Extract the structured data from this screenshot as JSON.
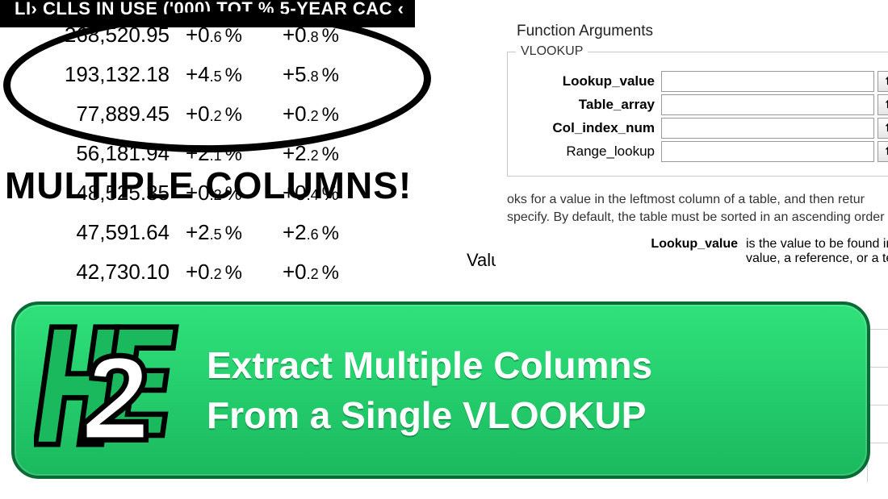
{
  "header": {
    "text": "LI› CLLS IN USE ('000)   TOT %   5-YEAR CAC ‹"
  },
  "table": {
    "rows": [
      {
        "val": "268,520.95",
        "tot_big": "+0",
        "tot_sm": ".6",
        "cagr_big": "+0",
        "cagr_sm": ".8"
      },
      {
        "val": "193,132.18",
        "tot_big": "+4",
        "tot_sm": ".5",
        "cagr_big": "+5",
        "cagr_sm": ".8"
      },
      {
        "val": "77,889.45",
        "tot_big": "+0",
        "tot_sm": ".2",
        "cagr_big": "+0",
        "cagr_sm": ".2"
      },
      {
        "val": "56,181.94",
        "tot_big": "+2",
        "tot_sm": ".1",
        "cagr_big": "+2",
        "cagr_sm": ".2"
      },
      {
        "val": "48,525.35",
        "tot_big": "+0",
        "tot_sm": ".2",
        "cagr_big": "+0",
        "cagr_sm": ".4"
      },
      {
        "val": "47,591.64",
        "tot_big": "+2",
        "tot_sm": ".5",
        "cagr_big": "+2",
        "cagr_sm": ".6"
      },
      {
        "val": "42,730.10",
        "tot_big": "+0",
        "tot_sm": ".2",
        "cagr_big": "+0",
        "cagr_sm": ".2"
      }
    ],
    "pct_unit": "%"
  },
  "overlay": "MULTIPLE COLUMNS!",
  "valu_frag": "Valu",
  "dialog": {
    "title": "Function Arguments",
    "legend": "VLOOKUP",
    "args": [
      {
        "label": "Lookup_value",
        "bold": true
      },
      {
        "label": "Table_array",
        "bold": true
      },
      {
        "label": "Col_index_num",
        "bold": true
      },
      {
        "label": "Range_lookup",
        "bold": false
      }
    ],
    "desc1": "oks for a value in the leftmost column of a table, and then retur",
    "desc2": "specify. By default, the table must be sorted in an ascending order",
    "arg_name": "Lookup_value",
    "arg_help1": "is the value to be found in",
    "arg_help2": "value, a reference, or a tex"
  },
  "banner": {
    "line1": "Extract Multiple Columns",
    "line2": "From a Single VLOOKUP"
  }
}
